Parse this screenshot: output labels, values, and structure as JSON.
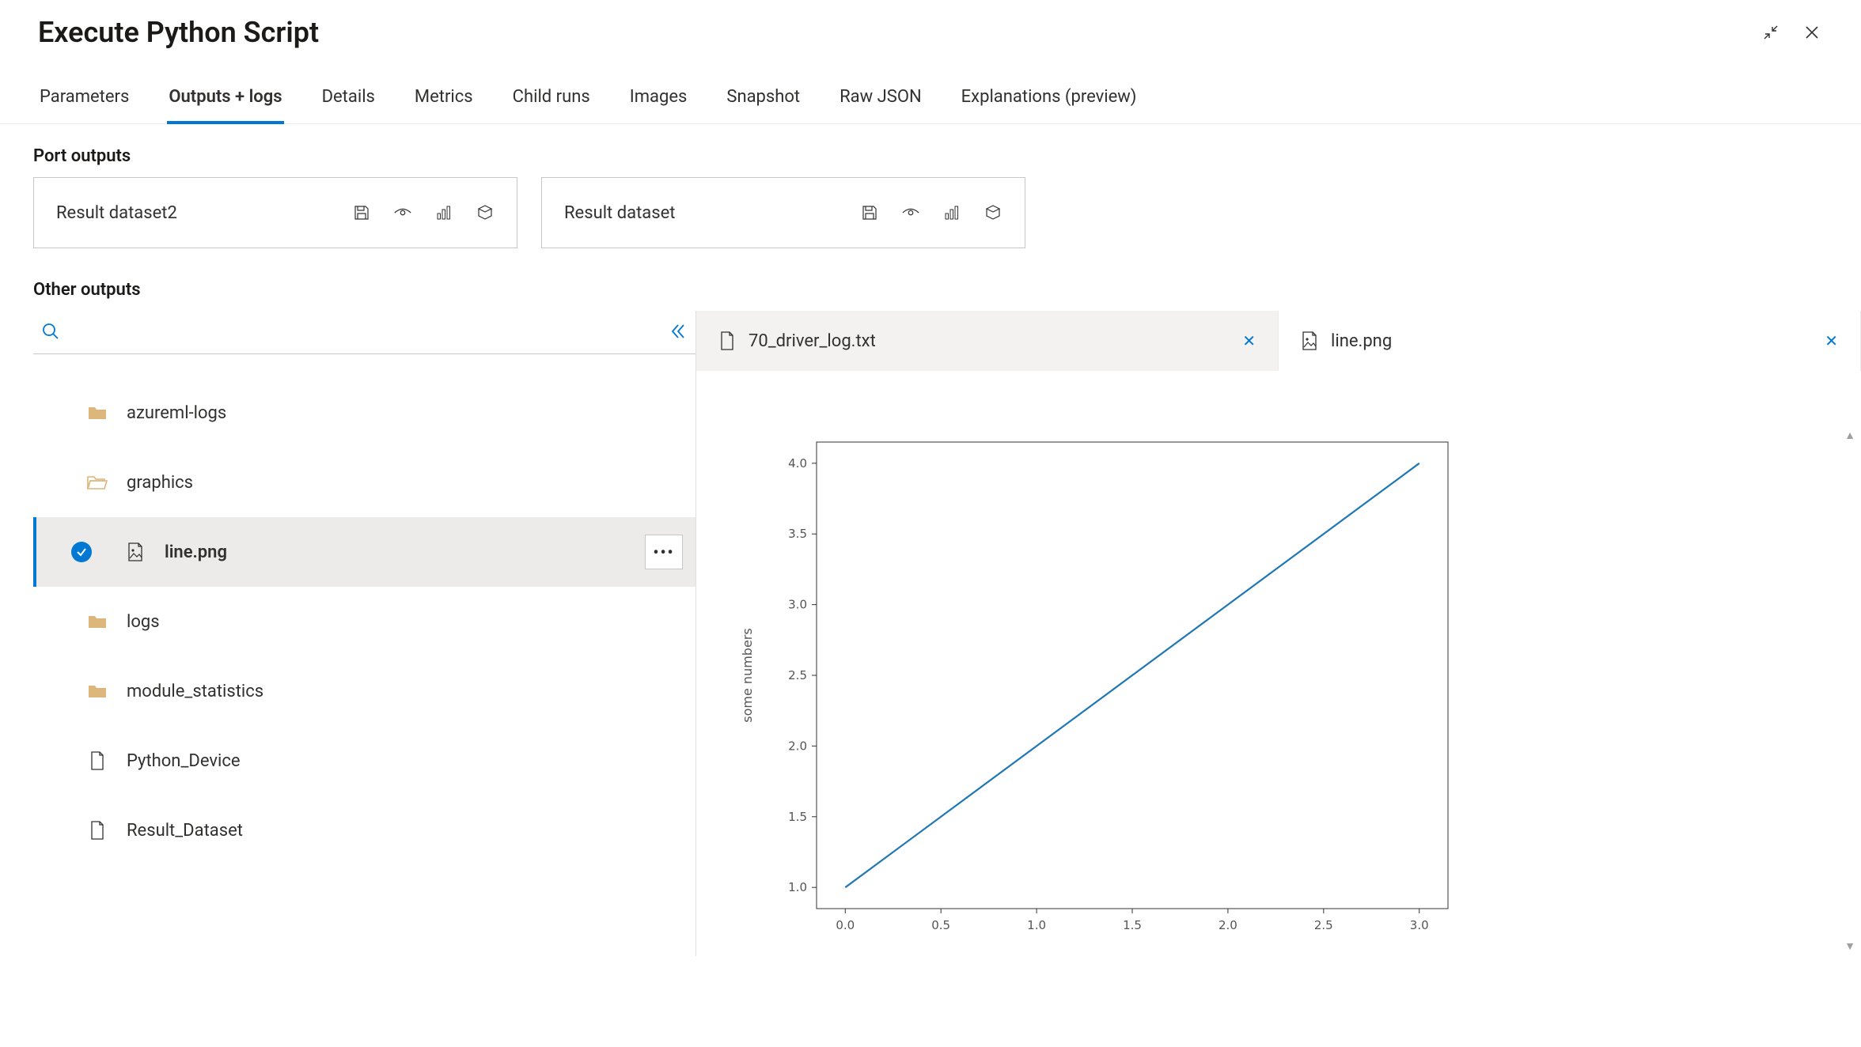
{
  "panel": {
    "title": "Execute Python Script"
  },
  "tabs": [
    {
      "label": "Parameters",
      "active": false
    },
    {
      "label": "Outputs + logs",
      "active": true
    },
    {
      "label": "Details",
      "active": false
    },
    {
      "label": "Metrics",
      "active": false
    },
    {
      "label": "Child runs",
      "active": false
    },
    {
      "label": "Images",
      "active": false
    },
    {
      "label": "Snapshot",
      "active": false
    },
    {
      "label": "Raw JSON",
      "active": false
    },
    {
      "label": "Explanations (preview)",
      "active": false
    }
  ],
  "sections": {
    "port_outputs_h": "Port outputs",
    "port_outputs": [
      {
        "label": "Result dataset2"
      },
      {
        "label": "Result dataset"
      }
    ],
    "other_outputs_h": "Other outputs"
  },
  "tree": [
    {
      "label": "azureml-logs",
      "type": "folder"
    },
    {
      "label": "graphics",
      "type": "folder-open"
    },
    {
      "label": "line.png",
      "type": "image",
      "selected": true
    },
    {
      "label": "logs",
      "type": "folder"
    },
    {
      "label": "module_statistics",
      "type": "folder"
    },
    {
      "label": "Python_Device",
      "type": "file"
    },
    {
      "label": "Result_Dataset",
      "type": "file"
    }
  ],
  "file_tabs": [
    {
      "name": "70_driver_log.txt",
      "type": "file",
      "active": true
    },
    {
      "name": "line.png",
      "type": "image",
      "active": false
    }
  ],
  "chart_data": {
    "type": "line",
    "x": [
      0.0,
      1.0,
      2.0,
      3.0
    ],
    "y": [
      1.0,
      2.0,
      3.0,
      4.0
    ],
    "xlabel": "",
    "ylabel": "some numbers",
    "xlim": [
      -0.15,
      3.15
    ],
    "ylim": [
      0.85,
      4.15
    ],
    "xticks": [
      0.0,
      0.5,
      1.0,
      1.5,
      2.0,
      2.5,
      3.0
    ],
    "yticks": [
      1.0,
      1.5,
      2.0,
      2.5,
      3.0,
      3.5,
      4.0
    ]
  }
}
